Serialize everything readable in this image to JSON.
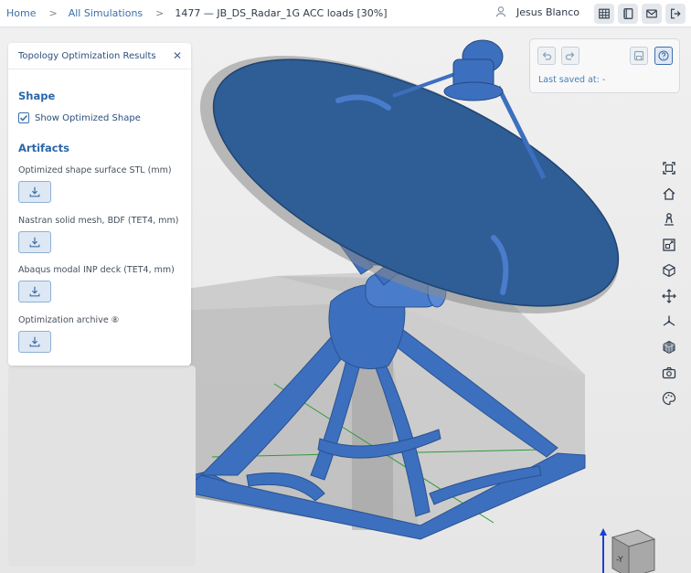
{
  "breadcrumb": {
    "home": "Home",
    "all": "All Simulations",
    "current": "1477 — JB_DS_Radar_1G ACC loads [30%]",
    "separator": ">"
  },
  "user": {
    "name": "Jesus Blanco",
    "icon": "user-icon"
  },
  "toolbar_icons": [
    "table-icon",
    "notebook-icon",
    "mail-icon",
    "logout-icon"
  ],
  "panel": {
    "title": "Topology Optimization Results",
    "close": "✕",
    "shape_heading": "Shape",
    "show_optimized": {
      "label": "Show Optimized Shape",
      "checked": true
    },
    "artifacts_heading": "Artifacts",
    "artifacts": [
      {
        "label": "Optimized shape surface STL (mm)"
      },
      {
        "label": "Nastran solid mesh, BDF (TET4, mm)"
      },
      {
        "label": "Abaqus modal INP deck (TET4, mm)"
      },
      {
        "label": "Optimization archive ⑧"
      }
    ]
  },
  "save_panel": {
    "last_saved": "Last saved at: -"
  },
  "view_tools": [
    "fit-view-icon",
    "home-view-icon",
    "person-view-icon",
    "zoom-region-icon",
    "cube-view-icon",
    "pan-icon",
    "axes-icon",
    "mesh-cube-icon",
    "camera-icon",
    "palette-icon"
  ],
  "axis_cube": {
    "face_label": "-Y"
  },
  "colors": {
    "accent": "#3d6fa8",
    "model": "#3f6fbf",
    "dish": "#2f5d96"
  }
}
